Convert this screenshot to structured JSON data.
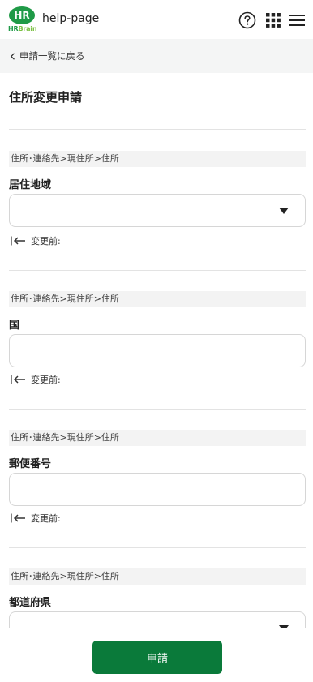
{
  "header": {
    "logo_mark": "HR",
    "logo_word_hr": "HR",
    "logo_word_brain": "Brain",
    "title": "help-page",
    "icons": [
      "help-circle-icon",
      "apps-grid-icon",
      "hamburger-menu-icon"
    ]
  },
  "back": {
    "label": "申請一覧に戻る"
  },
  "form": {
    "title": "住所変更申請",
    "sections": [
      {
        "path": "住所･連絡先>現住所>住所",
        "label": "居住地域",
        "type": "select",
        "value": "",
        "previous_label": "変更前:"
      },
      {
        "path": "住所･連絡先>現住所>住所",
        "label": "国",
        "type": "text",
        "value": "",
        "previous_label": "変更前:"
      },
      {
        "path": "住所･連絡先>現住所>住所",
        "label": "郵便番号",
        "type": "text",
        "value": "",
        "previous_label": "変更前:"
      },
      {
        "path": "住所･連絡先>現住所>住所",
        "label": "都道府県",
        "type": "select",
        "value": ""
      }
    ]
  },
  "footer": {
    "submit_label": "申請"
  },
  "colors": {
    "brand_green": "#1f9a47",
    "button_green": "#0a7a3a",
    "section_bg": "#f3f3f3",
    "backbar_bg": "#f4f5f5"
  }
}
